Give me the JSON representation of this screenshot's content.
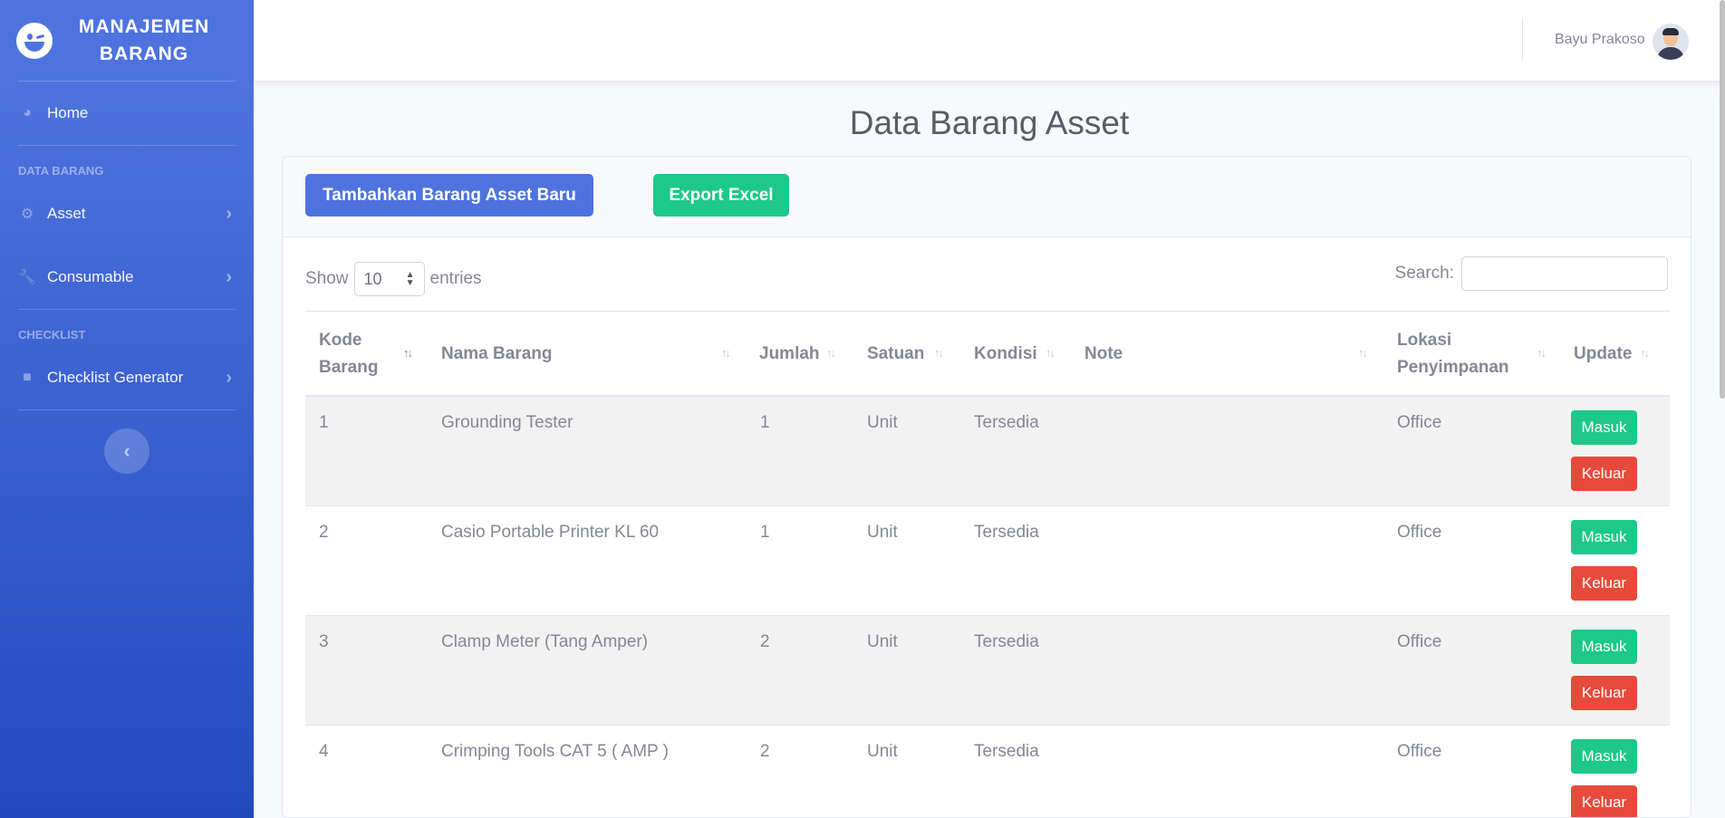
{
  "sidebar": {
    "brand": "MANAJEMEN BARANG",
    "items": [
      {
        "label": "Home"
      },
      {
        "label": "Asset"
      },
      {
        "label": "Consumable"
      },
      {
        "label": "Checklist Generator"
      }
    ],
    "headings": [
      "DATA BARANG",
      "CHECKLIST"
    ]
  },
  "topbar": {
    "user_name": "Bayu Prakoso"
  },
  "page": {
    "title": "Data Barang Asset"
  },
  "actions": {
    "add_label": "Tambahkan Barang Asset Baru",
    "export_label": "Export Excel"
  },
  "table_controls": {
    "show_label": "Show",
    "entries_value": "10",
    "entries_label": "entries",
    "search_label": "Search:",
    "search_value": ""
  },
  "table": {
    "columns": [
      "Kode Barang",
      "Nama Barang",
      "Jumlah",
      "Satuan",
      "Kondisi",
      "Note",
      "Lokasi Penyimpanan",
      "Update"
    ],
    "rows": [
      {
        "kode": "1",
        "nama": "Grounding Tester",
        "jumlah": "1",
        "satuan": "Unit",
        "kondisi": "Tersedia",
        "note": "",
        "lokasi": "Office"
      },
      {
        "kode": "2",
        "nama": "Casio Portable Printer KL 60",
        "jumlah": "1",
        "satuan": "Unit",
        "kondisi": "Tersedia",
        "note": "",
        "lokasi": "Office"
      },
      {
        "kode": "3",
        "nama": "Clamp Meter (Tang Amper)",
        "jumlah": "2",
        "satuan": "Unit",
        "kondisi": "Tersedia",
        "note": "",
        "lokasi": "Office"
      },
      {
        "kode": "4",
        "nama": "Crimping Tools CAT 5 ( AMP )",
        "jumlah": "2",
        "satuan": "Unit",
        "kondisi": "Tersedia",
        "note": "",
        "lokasi": "Office"
      }
    ],
    "masuk_label": "Masuk",
    "keluar_label": "Keluar"
  },
  "colors": {
    "primary": "#4e73df",
    "success": "#1cc88a",
    "danger": "#e74a3b",
    "text": "#858796"
  }
}
